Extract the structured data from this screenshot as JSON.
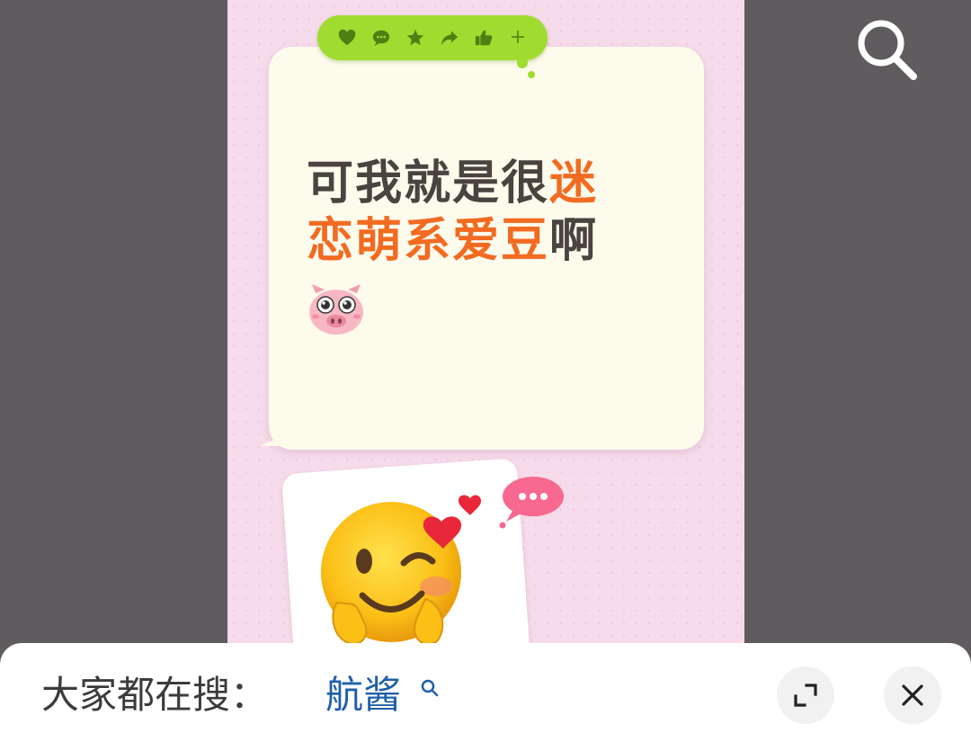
{
  "poster": {
    "headline_line1_normal": "可我就是很",
    "headline_line1_accent": "迷",
    "headline_line2_accent": "恋萌系爱豆",
    "headline_line2_normal": "啊",
    "reactions": [
      "heart-icon",
      "comment-icon",
      "star-icon",
      "share-icon",
      "thumbs-up-icon",
      "plus-icon"
    ],
    "plus_symbol": "+"
  },
  "bottom_bar": {
    "prompt_label": "大家都在搜：",
    "search_term": "航酱"
  },
  "colors": {
    "accent": "#f26b21",
    "headline": "#4a4440",
    "reaction_bar": "#9fdc2f",
    "poster_bg": "#f6dbea",
    "link_blue": "#1f5fa8"
  }
}
